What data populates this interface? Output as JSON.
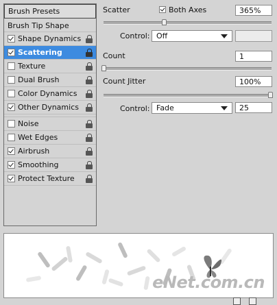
{
  "panel": {
    "presets_label": "Brush Presets",
    "tip_shape_label": "Brush Tip Shape",
    "options_group1": [
      {
        "label": "Shape Dynamics",
        "checked": true,
        "selected": false
      },
      {
        "label": "Scattering",
        "checked": true,
        "selected": true
      },
      {
        "label": "Texture",
        "checked": false,
        "selected": false
      },
      {
        "label": "Dual Brush",
        "checked": false,
        "selected": false
      },
      {
        "label": "Color Dynamics",
        "checked": false,
        "selected": false
      },
      {
        "label": "Other Dynamics",
        "checked": true,
        "selected": false
      }
    ],
    "options_group2": [
      {
        "label": "Noise",
        "checked": false
      },
      {
        "label": "Wet Edges",
        "checked": false
      },
      {
        "label": "Airbrush",
        "checked": true
      },
      {
        "label": "Smoothing",
        "checked": true
      },
      {
        "label": "Protect Texture",
        "checked": true
      }
    ]
  },
  "scatter": {
    "label": "Scatter",
    "both_axes_label": "Both Axes",
    "both_axes_checked": true,
    "value": "365%",
    "control_label": "Control:",
    "control_value": "Off"
  },
  "count": {
    "label": "Count",
    "value": "1"
  },
  "count_jitter": {
    "label": "Count Jitter",
    "value": "100%",
    "control_label": "Control:",
    "control_value": "Fade",
    "fade_steps": "25"
  },
  "watermark": "eNet.com.cn",
  "icons": {
    "lock": "lock-icon",
    "new": "new-preset-icon",
    "trash": "trash-icon"
  }
}
